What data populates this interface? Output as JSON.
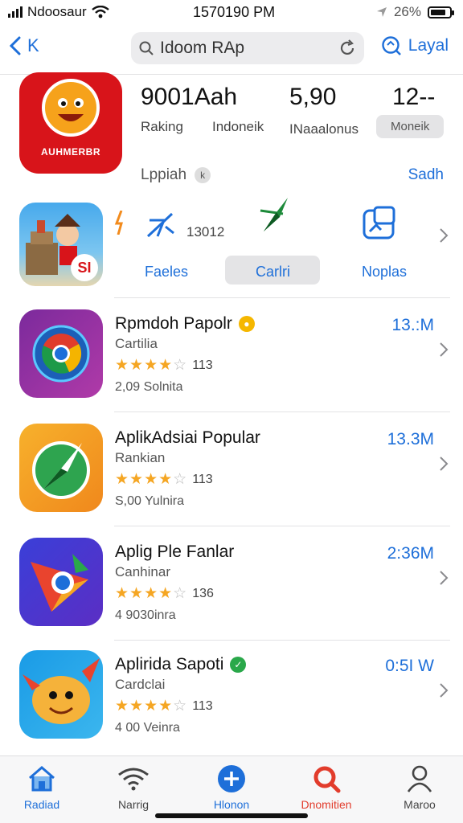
{
  "status_bar": {
    "carrier": "Ndoosaur",
    "time": "1570190 PM",
    "battery_text": "26%"
  },
  "nav": {
    "back_label": "K",
    "search_query": "Idoom RAp",
    "right_label": "Layal"
  },
  "featured": {
    "icon_caption": "AUHMERBR",
    "stats": [
      {
        "value": "9001Aah",
        "label": "Raking"
      },
      {
        "value": "5,90",
        "label": "Indoneik"
      },
      {
        "value": "12--",
        "label": "INaaalonus"
      }
    ],
    "pill": "Moneik",
    "sub_left": "Lppiah",
    "sub_right": "Sadh"
  },
  "categories": {
    "count": "13012",
    "labels": [
      "Faeles",
      "Carlri",
      "Noplas"
    ],
    "badge": "SI"
  },
  "apps": [
    {
      "title": "Rpmdoh Papolr",
      "subtitle": "Cartilia",
      "rating_count": "113",
      "meta": "2,09 Solnita",
      "size": "13.:M",
      "stars": 4,
      "badge_color": "#f5b700"
    },
    {
      "title": "AplikAdsiai Popular",
      "subtitle": "Rankian",
      "rating_count": "113",
      "meta": "S,00 Yulnira",
      "size": "13.3M",
      "stars": 4,
      "badge_color": ""
    },
    {
      "title": "Aplig Ple Fanlar",
      "subtitle": "Canhinar",
      "rating_count": "136",
      "meta": "4 9030inra",
      "size": "2:36M",
      "stars": 4,
      "badge_color": ""
    },
    {
      "title": "Aplirida Sapoti",
      "subtitle": "Cardclai",
      "rating_count": "113",
      "meta": "4 00 Veinra",
      "size": "0:5I W",
      "stars": 4,
      "badge_color": "#2aa84a"
    }
  ],
  "tabs": [
    {
      "label": "Radiad",
      "icon": "home-icon",
      "color": "#1e6fd9"
    },
    {
      "label": "Narrig",
      "icon": "wifi-icon",
      "color": "#444444"
    },
    {
      "label": "Hlonon",
      "icon": "plus-icon",
      "color": "#1e6fd9"
    },
    {
      "label": "Dnomitien",
      "icon": "search-icon",
      "color": "#e23c2c"
    },
    {
      "label": "Maroo",
      "icon": "person-icon",
      "color": "#444444"
    }
  ]
}
